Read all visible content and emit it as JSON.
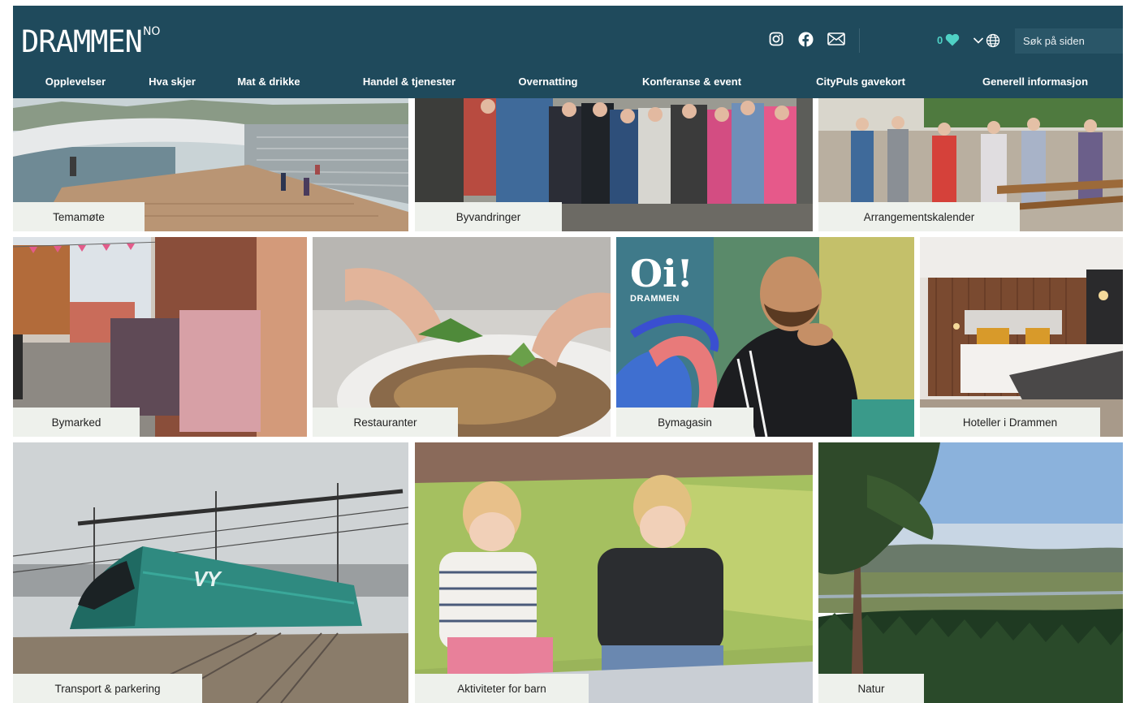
{
  "header": {
    "logo": {
      "main": "DRAMMEN",
      "sup": "NO"
    },
    "social": {
      "instagram": "instagram-icon",
      "facebook": "facebook-icon",
      "email": "mail-icon"
    },
    "favorites_count": "0",
    "search_placeholder": "Søk på siden"
  },
  "nav": [
    "Opplevelser",
    "Hva skjer",
    "Mat & drikke",
    "Handel & tjenester",
    "Overnatting",
    "Konferanse & event",
    "CityPuls gavekort",
    "Generell informasjon"
  ],
  "tiles": [
    {
      "label": "Temamøte"
    },
    {
      "label": "Byvandringer"
    },
    {
      "label": "Arrangementskalender"
    },
    {
      "label": "Bymarked"
    },
    {
      "label": "Restauranter"
    },
    {
      "label": "Bymagasin",
      "badge": {
        "big": "Oi!",
        "small": "DRAMMEN"
      }
    },
    {
      "label": "Hoteller i Drammen"
    },
    {
      "label": "Transport & parkering",
      "train_logo": "VY"
    },
    {
      "label": "Aktiviteter for barn"
    },
    {
      "label": "Natur"
    }
  ],
  "colors": {
    "header_bg": "#1f4a5c",
    "accent": "#4fd1c5",
    "label_bg": "#eef1ec"
  }
}
